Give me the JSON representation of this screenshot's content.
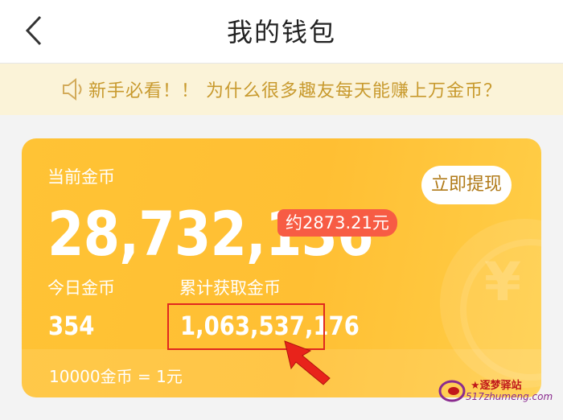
{
  "header": {
    "title": "我的钱包"
  },
  "notice": {
    "text": "新手必看！！ 为什么很多趣友每天能赚上万金币？"
  },
  "wallet": {
    "current_label": "当前金币",
    "current_value": "28,732,136",
    "approx_value": "约2873.21元",
    "withdraw_label": "立即提现",
    "today_label": "今日金币",
    "today_value": "354",
    "total_label": "累计获取金币",
    "total_value": "1,063,537,176",
    "rate_text": "10000金币 = 1元",
    "card_colors": [
      "#ffc335",
      "#ffce48"
    ],
    "approx_badge_color": "#f75c44"
  },
  "annotation": {
    "highlight_color": "#e0281f"
  },
  "watermark": {
    "cn": "逐梦驿站",
    "en": "517zhumeng.com"
  }
}
